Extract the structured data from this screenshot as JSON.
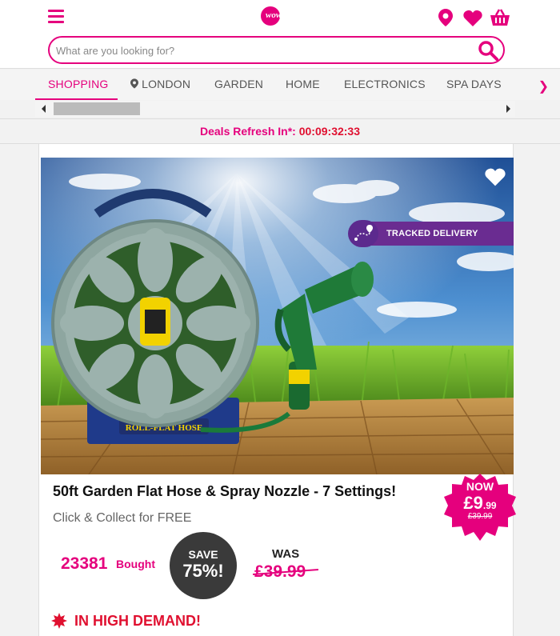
{
  "header": {
    "logo_text": "wowcher",
    "search_placeholder": "What are you looking for?"
  },
  "nav": {
    "items": [
      "SHOPPING",
      "LONDON",
      "GARDEN",
      "HOME",
      "ELECTRONICS",
      "SPA DAYS"
    ]
  },
  "refresh": {
    "label": "Deals Refresh In*:",
    "time": "00:09:32:33"
  },
  "deal": {
    "badge": "TRACKED DELIVERY",
    "hose_label": "ROLL-FLAT HOSE",
    "title": "50ft Garden Flat Hose & Spray Nozzle - 7 Settings!",
    "subtitle": "Click & Collect for FREE",
    "now_label": "NOW",
    "now_price_main": "£9",
    "now_price_pence": ".99",
    "now_old_price": "£39.99",
    "bought_count": "23381",
    "bought_label": "Bought",
    "save_label": "SAVE",
    "save_value": "75%!",
    "was_label": "WAS",
    "was_price": "£39.99",
    "demand_text": "IN HIGH DEMAND!"
  },
  "colors": {
    "brand": "#e5007d",
    "badge_purple": "#6a2c91",
    "alert_red": "#e01030"
  }
}
